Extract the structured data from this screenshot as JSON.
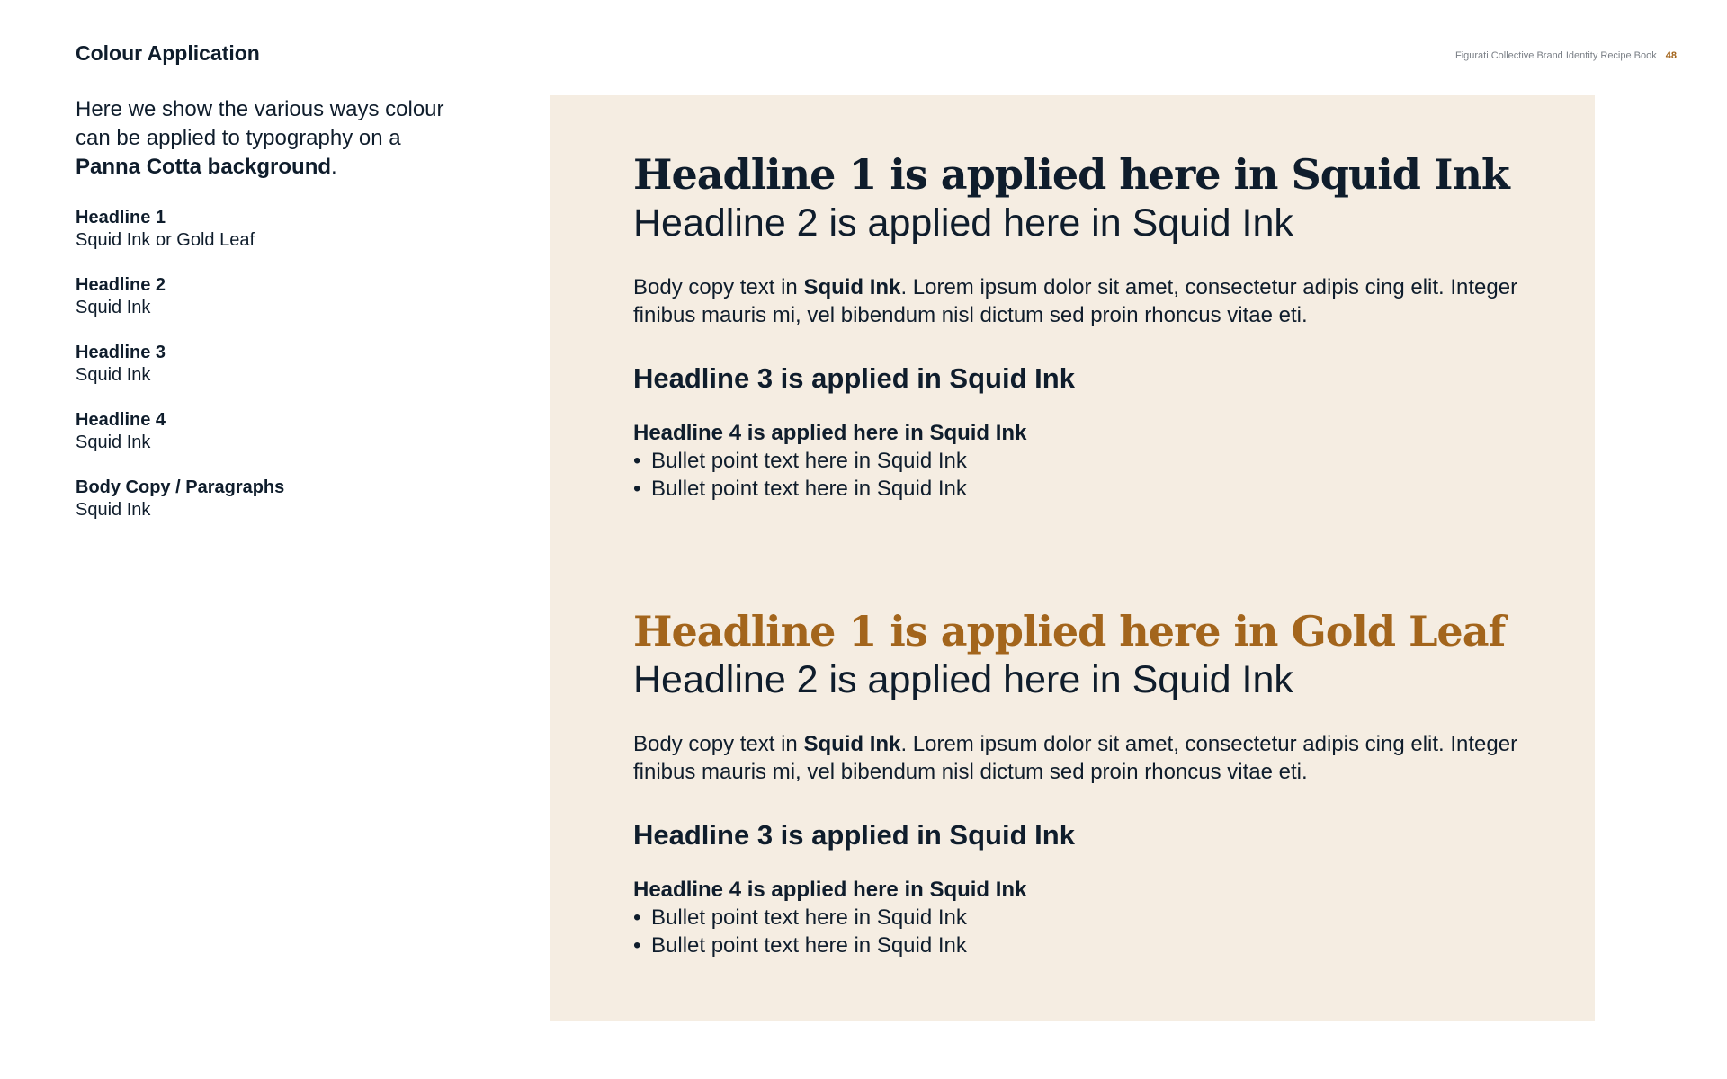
{
  "header": {
    "title": "Colour Application",
    "running_head": "Figurati Collective Brand Identity Recipe Book",
    "page_number": "48"
  },
  "intro": {
    "text_before": "Here we show the various ways colour can be applied to typography on a ",
    "bold": "Panna Cotta background",
    "text_after": "."
  },
  "legend": [
    {
      "title": "Headline 1",
      "desc": "Squid Ink or Gold Leaf"
    },
    {
      "title": "Headline 2",
      "desc": "Squid Ink"
    },
    {
      "title": "Headline 3",
      "desc": "Squid Ink"
    },
    {
      "title": "Headline 4",
      "desc": "Squid Ink"
    },
    {
      "title": "Body Copy / Paragraphs",
      "desc": "Squid Ink"
    }
  ],
  "samples": [
    {
      "h1": "Headline 1 is applied here in Squid Ink",
      "h2": "Headline 2 is applied here in Squid Ink",
      "body_prefix": "Body copy text in ",
      "body_bold": "Squid Ink",
      "body_suffix": ". Lorem ipsum dolor sit amet, consectetur adipis cing elit. Integer finibus mauris mi, vel bibendum nisl dictum sed proin rhoncus vitae eti.",
      "h3": "Headline 3 is applied in Squid Ink",
      "h4": "Headline 4 is applied here in Squid Ink",
      "bullets": [
        "Bullet point text here in Squid Ink",
        "Bullet point text here in Squid Ink"
      ]
    },
    {
      "h1": "Headline 1 is applied here in Gold Leaf",
      "h2": "Headline 2 is applied here in Squid Ink",
      "body_prefix": "Body copy text in ",
      "body_bold": "Squid Ink",
      "body_suffix": ". Lorem ipsum dolor sit amet, consectetur adipis cing elit. Integer finibus mauris mi, vel bibendum nisl dictum sed proin rhoncus vitae eti.",
      "h3": "Headline 3 is applied in Squid Ink",
      "h4": "Headline 4 is applied here in Squid Ink",
      "bullets": [
        "Bullet point text here in Squid Ink",
        "Bullet point text here in Squid Ink"
      ]
    }
  ],
  "colors": {
    "squid_ink": "#0f1d2c",
    "gold_leaf": "#a3651c",
    "panna_cotta": "#f5ede2"
  }
}
